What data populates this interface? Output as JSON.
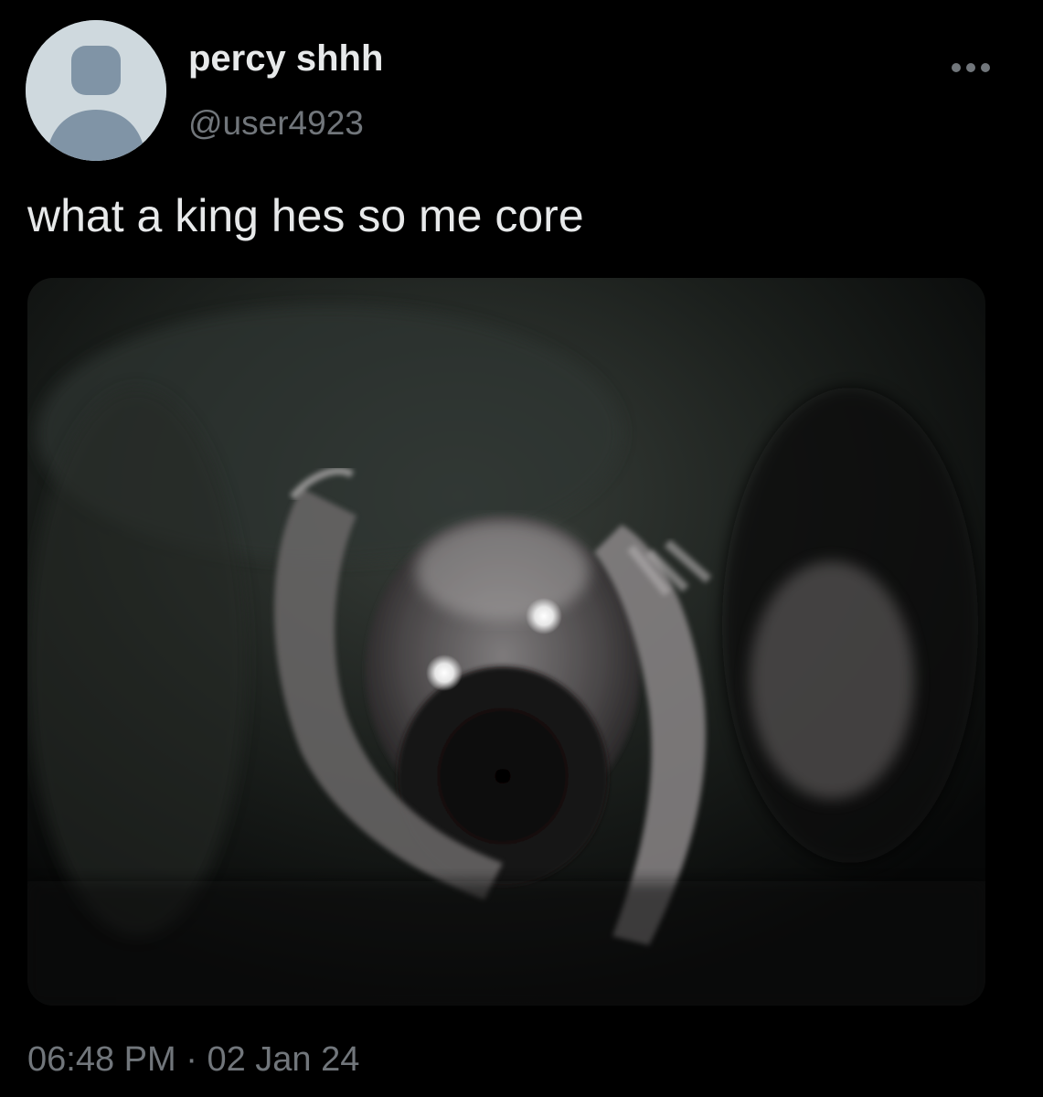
{
  "tweet": {
    "display_name": "percy shhh",
    "handle": "@user4923",
    "text": "what a king hes so me core",
    "time": "06:48 PM",
    "separator": " · ",
    "date": "02 Jan 24"
  },
  "icons": {
    "avatar": "default-avatar-icon",
    "more": "more-options-icon"
  },
  "colors": {
    "background": "#000000",
    "text_primary": "#e7e9ea",
    "text_secondary": "#71767b",
    "avatar_bg": "#cfd9de",
    "avatar_figure": "#8094a6"
  }
}
